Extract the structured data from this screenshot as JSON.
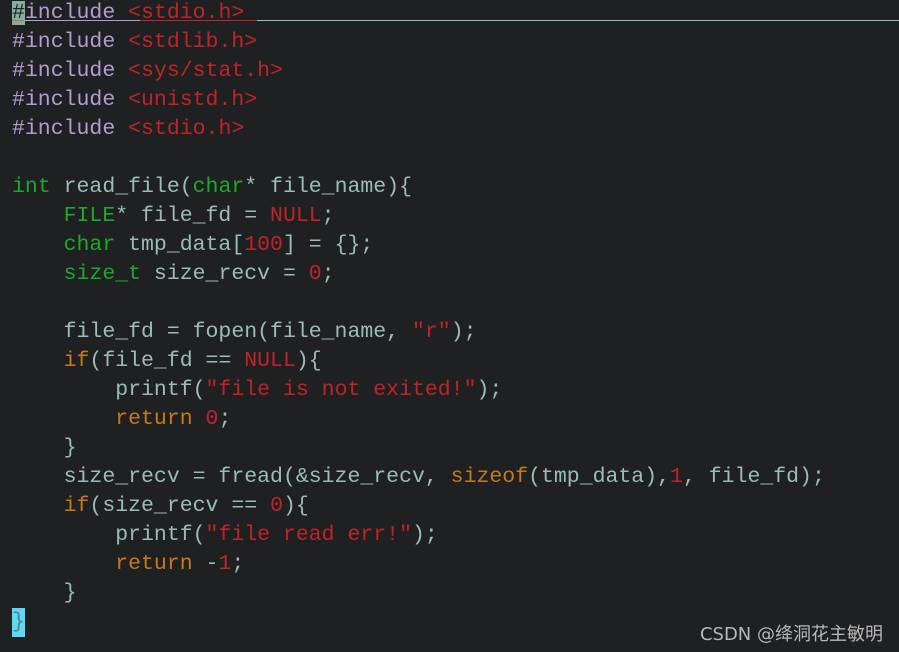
{
  "editor": {
    "colors": {
      "background": "#1f2022",
      "default": "#9cbcb6",
      "preprocessor": "#b29dd0",
      "string": "#c02428",
      "type": "#1ea82a",
      "keyword": "#c47a1c"
    },
    "lines": [
      [
        [
          "#",
          "cur"
        ],
        [
          "include ",
          "pre"
        ],
        [
          "<stdio.h>",
          "str"
        ]
      ],
      [
        [
          "#include ",
          "pre"
        ],
        [
          "<stdlib.h>",
          "str"
        ]
      ],
      [
        [
          "#include ",
          "pre"
        ],
        [
          "<sys/stat.h>",
          "str"
        ]
      ],
      [
        [
          "#include ",
          "pre"
        ],
        [
          "<unistd.h>",
          "str"
        ]
      ],
      [
        [
          "#include ",
          "pre"
        ],
        [
          "<stdio.h>",
          "str"
        ]
      ],
      [],
      [
        [
          "int",
          "type"
        ],
        [
          " read_file(",
          "default"
        ],
        [
          "char",
          "type"
        ],
        [
          "* file_name){",
          "default"
        ]
      ],
      [
        [
          "    ",
          "default"
        ],
        [
          "FILE",
          "type"
        ],
        [
          "* file_fd = ",
          "default"
        ],
        [
          "NULL",
          "str"
        ],
        [
          ";",
          "default"
        ]
      ],
      [
        [
          "    ",
          "default"
        ],
        [
          "char",
          "type"
        ],
        [
          " tmp_data[",
          "default"
        ],
        [
          "100",
          "num"
        ],
        [
          "] = {};",
          "default"
        ]
      ],
      [
        [
          "    ",
          "default"
        ],
        [
          "size_t",
          "type"
        ],
        [
          " size_recv = ",
          "default"
        ],
        [
          "0",
          "num"
        ],
        [
          ";",
          "default"
        ]
      ],
      [],
      [
        [
          "    file_fd = fopen(file_name, ",
          "default"
        ],
        [
          "\"r\"",
          "str"
        ],
        [
          ");",
          "default"
        ]
      ],
      [
        [
          "    ",
          "default"
        ],
        [
          "if",
          "kw"
        ],
        [
          "(file_fd == ",
          "default"
        ],
        [
          "NULL",
          "str"
        ],
        [
          "){",
          "default"
        ]
      ],
      [
        [
          "        printf(",
          "default"
        ],
        [
          "\"file is not exited!\"",
          "str"
        ],
        [
          ");",
          "default"
        ]
      ],
      [
        [
          "        ",
          "default"
        ],
        [
          "return",
          "kw"
        ],
        [
          " ",
          "default"
        ],
        [
          "0",
          "num"
        ],
        [
          ";",
          "default"
        ]
      ],
      [
        [
          "    }",
          "default"
        ]
      ],
      [
        [
          "    size_recv = fread(&size_recv, ",
          "default"
        ],
        [
          "sizeof",
          "kw"
        ],
        [
          "(tmp_data),",
          "default"
        ],
        [
          "1",
          "num"
        ],
        [
          ", file_fd);",
          "default"
        ]
      ],
      [
        [
          "    ",
          "default"
        ],
        [
          "if",
          "kw"
        ],
        [
          "(size_recv == ",
          "default"
        ],
        [
          "0",
          "num"
        ],
        [
          "){",
          "default"
        ]
      ],
      [
        [
          "        printf(",
          "default"
        ],
        [
          "\"file read err!\"",
          "str"
        ],
        [
          ");",
          "default"
        ]
      ],
      [
        [
          "        ",
          "default"
        ],
        [
          "return",
          "kw"
        ],
        [
          " -",
          "default"
        ],
        [
          "1",
          "num"
        ],
        [
          ";",
          "default"
        ]
      ],
      [
        [
          "    }",
          "default"
        ]
      ],
      [
        [
          "}",
          "brace-cur"
        ]
      ]
    ]
  },
  "watermark": "CSDN @绛洞花主敏明"
}
